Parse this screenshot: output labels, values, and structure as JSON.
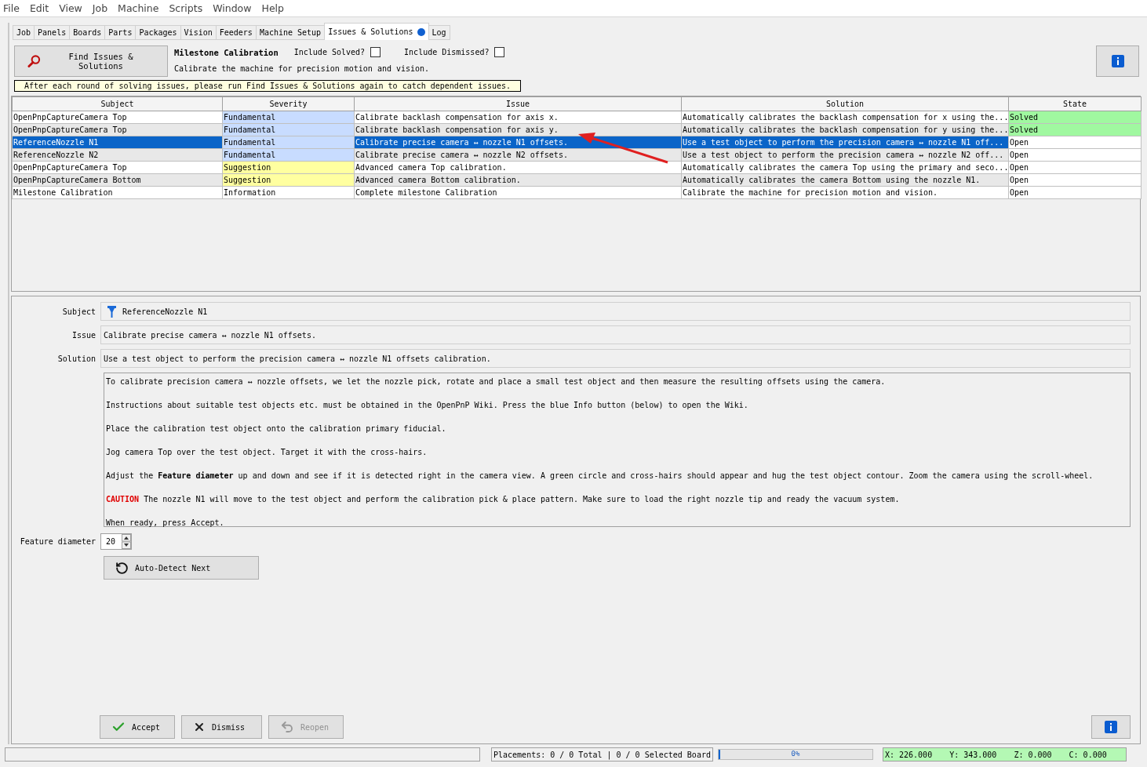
{
  "menu": [
    "File",
    "Edit",
    "View",
    "Job",
    "Machine",
    "Scripts",
    "Window",
    "Help"
  ],
  "tabs": [
    {
      "label": "Job",
      "selected": false,
      "alert": false
    },
    {
      "label": "Panels",
      "selected": false,
      "alert": false
    },
    {
      "label": "Boards",
      "selected": false,
      "alert": false
    },
    {
      "label": "Parts",
      "selected": false,
      "alert": false
    },
    {
      "label": "Packages",
      "selected": false,
      "alert": false
    },
    {
      "label": "Vision",
      "selected": false,
      "alert": false
    },
    {
      "label": "Feeders",
      "selected": false,
      "alert": false
    },
    {
      "label": "Machine Setup",
      "selected": false,
      "alert": false
    },
    {
      "label": "Issues & Solutions",
      "selected": true,
      "alert": true
    },
    {
      "label": "Log",
      "selected": false,
      "alert": false
    }
  ],
  "toolbar": {
    "find_button": "Find Issues & Solutions",
    "milestone": "Milestone Calibration",
    "milestone_description": "Calibrate the machine for precision motion and vision.",
    "include_solved": {
      "label": "Include Solved?",
      "checked": false
    },
    "include_dismissed": {
      "label": "Include Dismissed?",
      "checked": false
    },
    "hint": "After each round of solving issues, please run Find Issues & Solutions again to catch dependent issues."
  },
  "table": {
    "columns": [
      "Subject",
      "Severity",
      "Issue",
      "Solution",
      "State"
    ],
    "rows": [
      {
        "subject": "OpenPnpCaptureCamera Top",
        "severity": {
          "label": "Fundamental",
          "color": "#c8dcff"
        },
        "issue": "Calibrate backlash compensation for axis x.",
        "solution": "Automatically calibrates the backlash compensation for x using the...",
        "state": {
          "label": "Solved",
          "color": "#a0f8a0"
        },
        "selected": false
      },
      {
        "subject": "OpenPnpCaptureCamera Top",
        "severity": {
          "label": "Fundamental",
          "color": "#c8dcff"
        },
        "issue": "Calibrate backlash compensation for axis y.",
        "solution": "Automatically calibrates the backlash compensation for y using the...",
        "state": {
          "label": "Solved",
          "color": "#a0f8a0"
        },
        "selected": false
      },
      {
        "subject": "ReferenceNozzle N1",
        "severity": {
          "label": "Fundamental",
          "color": "#c8dcff"
        },
        "issue": "Calibrate precise camera ↔ nozzle N1 offsets.",
        "solution": "Use a test object to perform the precision camera ↔ nozzle N1 off...",
        "state": {
          "label": "Open",
          "color": "#ffffff"
        },
        "selected": true
      },
      {
        "subject": "ReferenceNozzle N2",
        "severity": {
          "label": "Fundamental",
          "color": "#c8dcff"
        },
        "issue": "Calibrate precise camera ↔ nozzle N2 offsets.",
        "solution": "Use a test object to perform the precision camera ↔ nozzle N2 off...",
        "state": {
          "label": "Open",
          "color": "#ffffff"
        },
        "selected": false
      },
      {
        "subject": "OpenPnpCaptureCamera Top",
        "severity": {
          "label": "Suggestion",
          "color": "#ffffa0"
        },
        "issue": "Advanced camera Top calibration.",
        "solution": "Automatically calibrates the camera Top using the primary and seco...",
        "state": {
          "label": "Open",
          "color": "#ffffff"
        },
        "selected": false
      },
      {
        "subject": "OpenPnpCaptureCamera Bottom",
        "severity": {
          "label": "Suggestion",
          "color": "#ffffa0"
        },
        "issue": "Advanced camera Bottom calibration.",
        "solution": "Automatically calibrates the camera Bottom using the nozzle N1.",
        "state": {
          "label": "Open",
          "color": "#ffffff"
        },
        "selected": false
      },
      {
        "subject": "Milestone Calibration",
        "severity": {
          "label": "Information",
          "color": "#ffffff"
        },
        "issue": "Complete milestone Calibration",
        "solution": "Calibrate the machine for precision motion and vision.",
        "state": {
          "label": "Open",
          "color": "#ffffff"
        },
        "selected": false
      }
    ]
  },
  "details": {
    "subject_label": "Subject",
    "subject": "ReferenceNozzle N1",
    "issue_label": "Issue",
    "issue": "Calibrate precise camera ↔ nozzle N1 offsets.",
    "solution_label": "Solution",
    "solution": "Use a test object to perform the precision camera ↔ nozzle N1 offsets calibration.",
    "instructions": [
      {
        "kind": "plain",
        "text": "To calibrate precision camera ↔ nozzle offsets, we let the nozzle pick, rotate and place a small test object and then measure the resulting offsets using the camera."
      },
      {
        "kind": "plain",
        "text": "Instructions about suitable test objects etc. must be obtained in the OpenPnP Wiki. Press the blue Info button (below) to open the Wiki."
      },
      {
        "kind": "plain",
        "text": "Place the calibration test object onto the calibration primary fiducial."
      },
      {
        "kind": "plain",
        "text": "Jog camera Top over the test object. Target it with the cross-hairs."
      },
      {
        "kind": "plain",
        "text": "Adjust the **Feature diameter** up and down and see if it is detected right in the camera view. A green circle and cross-hairs should appear and hug the test object contour. Zoom the camera using the scroll-wheel."
      },
      {
        "kind": "warning",
        "lead": "CAUTION",
        "text": "The nozzle N1 will move to the test object and perform the calibration pick & place pattern. Make sure to load the right nozzle tip and ready the vacuum system."
      },
      {
        "kind": "plain",
        "text": "When ready, press Accept."
      }
    ],
    "feature_label": "Feature diameter",
    "feature_value": "20",
    "auto_detect": "Auto-Detect Next",
    "actions": [
      {
        "kind": "accept",
        "label": "Accept",
        "disabled": false
      },
      {
        "kind": "dismiss",
        "label": "Dismiss",
        "disabled": false
      },
      {
        "kind": "reopen",
        "label": "Reopen",
        "disabled": true
      }
    ]
  },
  "status_bar": {
    "placements": "Placements: 0 / 0 Total | 0 / 0 Selected Board",
    "progress": {
      "label": "0%",
      "level": 0
    },
    "coordinates": [
      "X: 226.000",
      "Y: 343.000",
      "Z: 0.000",
      "C: 0.000"
    ]
  }
}
